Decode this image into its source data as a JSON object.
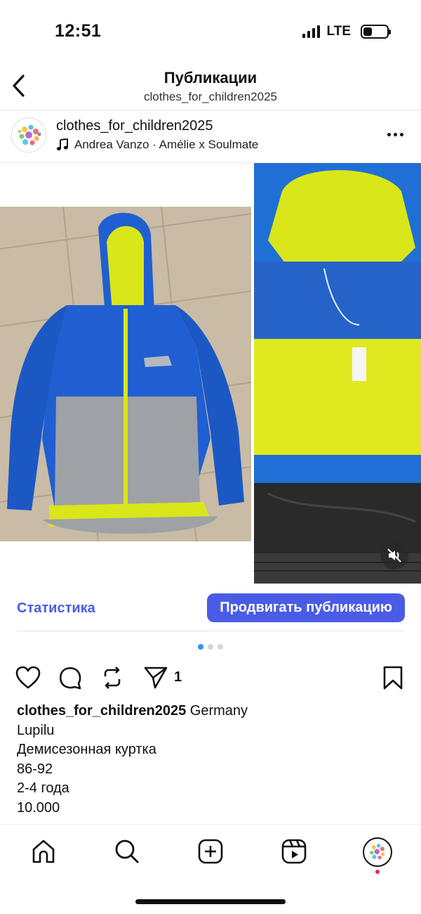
{
  "status_bar": {
    "time": "12:51",
    "network": "LTE",
    "battery_level": 0.35
  },
  "header": {
    "back_icon": "chevron-left-icon",
    "title": "Публикации",
    "subtitle": "clothes_for_children2025"
  },
  "post": {
    "username": "clothes_for_children2025",
    "audio_icon": "music-note-icon",
    "audio": "Andrea Vanzo · Amélie x Soulmate",
    "more_icon": "more-horizontal-icon",
    "media_count": 3,
    "media_active_index": 0,
    "mute_icon": "speaker-muted-icon"
  },
  "insights": {
    "statistics_label": "Статистика",
    "promote_label": "Продвигать публикацию",
    "accent_color": "#4a5ce6"
  },
  "actions": {
    "like_icon": "heart-icon",
    "comment_icon": "comment-icon",
    "repost_icon": "repost-icon",
    "share_icon": "paper-plane-icon",
    "share_count": "1",
    "save_icon": "bookmark-icon"
  },
  "caption": {
    "username": "clothes_for_children2025",
    "first_line": "Germany",
    "lines": [
      "Lupilu",
      "Демисезонная куртка",
      "86-92",
      "2-4 года",
      "10.000"
    ]
  },
  "tab_bar": {
    "items": [
      "home-icon",
      "search-icon",
      "create-icon",
      "reels-icon",
      "profile-avatar"
    ],
    "notification_color": "#e0245e"
  }
}
